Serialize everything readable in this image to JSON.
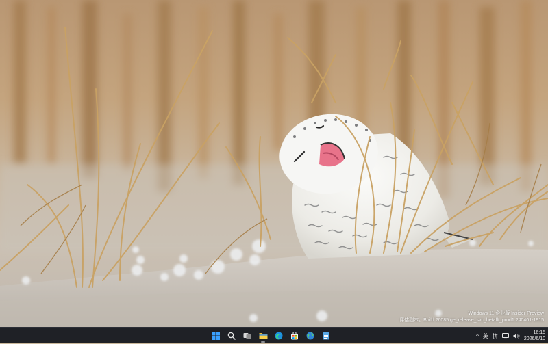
{
  "watermark": {
    "line1": "Windows 11 企业版 Insider Preview",
    "line2": "评估副本。Build 26085.ge_release_svc_betaflt_prod1.240401-1915"
  },
  "taskbar": {
    "apps": [
      {
        "name": "start",
        "icon": "windows-logo-icon"
      },
      {
        "name": "search",
        "icon": "search-icon"
      },
      {
        "name": "task-view",
        "icon": "task-view-icon"
      },
      {
        "name": "file-explorer",
        "icon": "folder-icon"
      },
      {
        "name": "edge",
        "icon": "edge-icon"
      },
      {
        "name": "store",
        "icon": "store-icon"
      },
      {
        "name": "browser",
        "icon": "globe-icon"
      },
      {
        "name": "notepad",
        "icon": "notepad-icon"
      }
    ],
    "tray": {
      "chevron": "^",
      "lang": "英",
      "ime": "拼",
      "time": "16:15",
      "date": "2026/6/10"
    }
  },
  "colors": {
    "taskbar_bg": "#1f2126",
    "accent": "#0078d4"
  }
}
